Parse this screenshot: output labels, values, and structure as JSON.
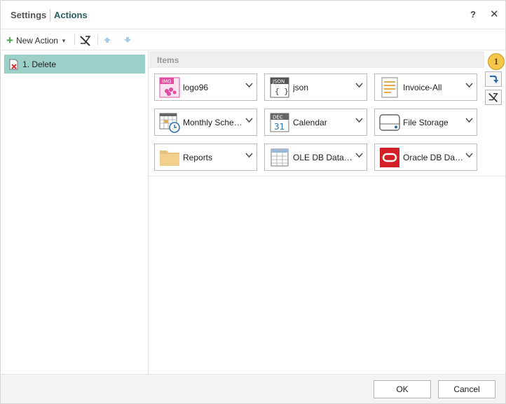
{
  "titlebar": {
    "settings_label": "Settings",
    "actions_label": "Actions",
    "help_label": "?",
    "close_label": "✕"
  },
  "toolbar": {
    "new_action_label": "New Action",
    "icons": [
      "plus-icon",
      "caret-icon",
      "remove-icon",
      "move-up-icon",
      "move-down-icon"
    ]
  },
  "actions": [
    {
      "label": "1. Delete",
      "icon": "delete-document-icon",
      "selected": true
    }
  ],
  "items_panel": {
    "title": "Items",
    "badge": "1",
    "tiles": [
      {
        "label": "logo96",
        "icon": "image-icon"
      },
      {
        "label": "json",
        "icon": "json-icon"
      },
      {
        "label": "Invoice-All",
        "icon": "report-icon"
      },
      {
        "label": "Monthly Schedule",
        "icon": "schedule-icon"
      },
      {
        "label": "Calendar",
        "icon": "calendar-icon"
      },
      {
        "label": "File Storage",
        "icon": "storage-icon"
      },
      {
        "label": "Reports",
        "icon": "folder-icon"
      },
      {
        "label": "OLE DB Data Source",
        "icon": "ole-db-icon"
      },
      {
        "label": "Oracle DB Data Source",
        "icon": "oracle-icon"
      }
    ],
    "image_tag": "IMG",
    "json_tag": "JSON",
    "json_braces": "{ }",
    "calendar_month": "DEC",
    "calendar_day": "31"
  },
  "footer": {
    "ok_label": "OK",
    "cancel_label": "Cancel"
  },
  "colors": {
    "selected_row": "#9bcfc8",
    "accent_text": "#2a5b5b",
    "badge": "#f5c74a",
    "plus": "#4aa34a",
    "oracle_red": "#d32027",
    "image_pink": "#e04ca0"
  }
}
